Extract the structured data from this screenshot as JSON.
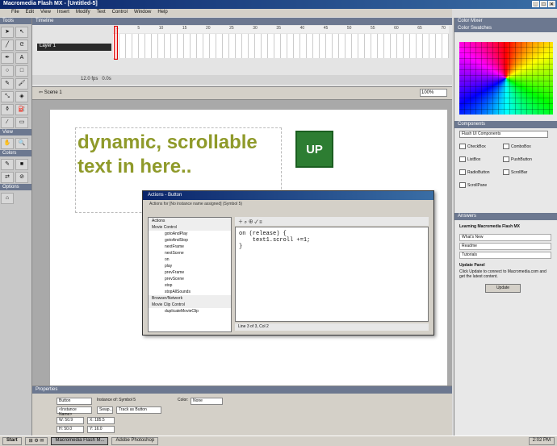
{
  "window": {
    "title": "Macromedia Flash MX - [Untitled-5]"
  },
  "menu": [
    "File",
    "Edit",
    "View",
    "Insert",
    "Modify",
    "Text",
    "Control",
    "Window",
    "Help"
  ],
  "tools": {
    "title": "Tools",
    "view_label": "View",
    "colors_label": "Colors",
    "options_label": "Options"
  },
  "timeline": {
    "title": "Timeline",
    "layer_name": "Layer 1",
    "fps": "12.0 fps",
    "time": "0.0s"
  },
  "scene": {
    "name": "Scene 1",
    "zoom": "100%"
  },
  "stage": {
    "dynamic_text": "dynamic, scrollable text in here..",
    "button_label": "UP"
  },
  "actions": {
    "title": "Actions - Button",
    "subtitle": "Actions for [No instance name assigned] (Symbol 5)",
    "tree": [
      {
        "label": "Actions",
        "cat": true
      },
      {
        "label": "Movie Control",
        "cat": true
      },
      {
        "label": "gotoAndPlay"
      },
      {
        "label": "gotoAndStop"
      },
      {
        "label": "nextFrame"
      },
      {
        "label": "nextScene"
      },
      {
        "label": "on"
      },
      {
        "label": "play"
      },
      {
        "label": "prevFrame"
      },
      {
        "label": "prevScene"
      },
      {
        "label": "stop"
      },
      {
        "label": "stopAllSounds"
      },
      {
        "label": "Browser/Network",
        "cat": true
      },
      {
        "label": "Movie Clip Control",
        "cat": true
      },
      {
        "label": "duplicateMovieClip"
      }
    ],
    "code_line1": "on (release) {",
    "code_line2": "    text1.scroll +=1;",
    "code_line3": "}",
    "status": "Line 3 of 3, Col 2"
  },
  "properties": {
    "title": "Properties",
    "behavior": "Button",
    "instance_of": "Instance of: Symbol 5",
    "instance_name": "<Instance Name>",
    "swap_label": "Swap...",
    "track": "Track as Button",
    "color_label": "Color:",
    "color_value": "None",
    "w": "W: 50.9",
    "h": "H: 50.0",
    "x": "X: 185.5",
    "y": "Y: 16.0"
  },
  "right": {
    "color_mixer": "Color Mixer",
    "color_swatches": "Color Swatches",
    "components": "Components",
    "components_set": "Flash UI Components",
    "component_items": [
      "CheckBox",
      "ComboBox",
      "ListBox",
      "PushButton",
      "RadioButton",
      "ScrollBar",
      "ScrollPane"
    ],
    "answers": "Answers",
    "learning": "Learning Macromedia Flash MX",
    "whats_new": "What's New",
    "readme": "Readme",
    "tutorials": "Tutorials",
    "update_title": "Update Panel",
    "update_text": "Click Update to connect to Macromedia.com and get the latest content.",
    "update_button": "Update"
  },
  "taskbar": {
    "start": "Start",
    "item1": "Macromedia Flash M...",
    "item2": "Adobe Photoshop",
    "clock": "2:02 PM"
  }
}
